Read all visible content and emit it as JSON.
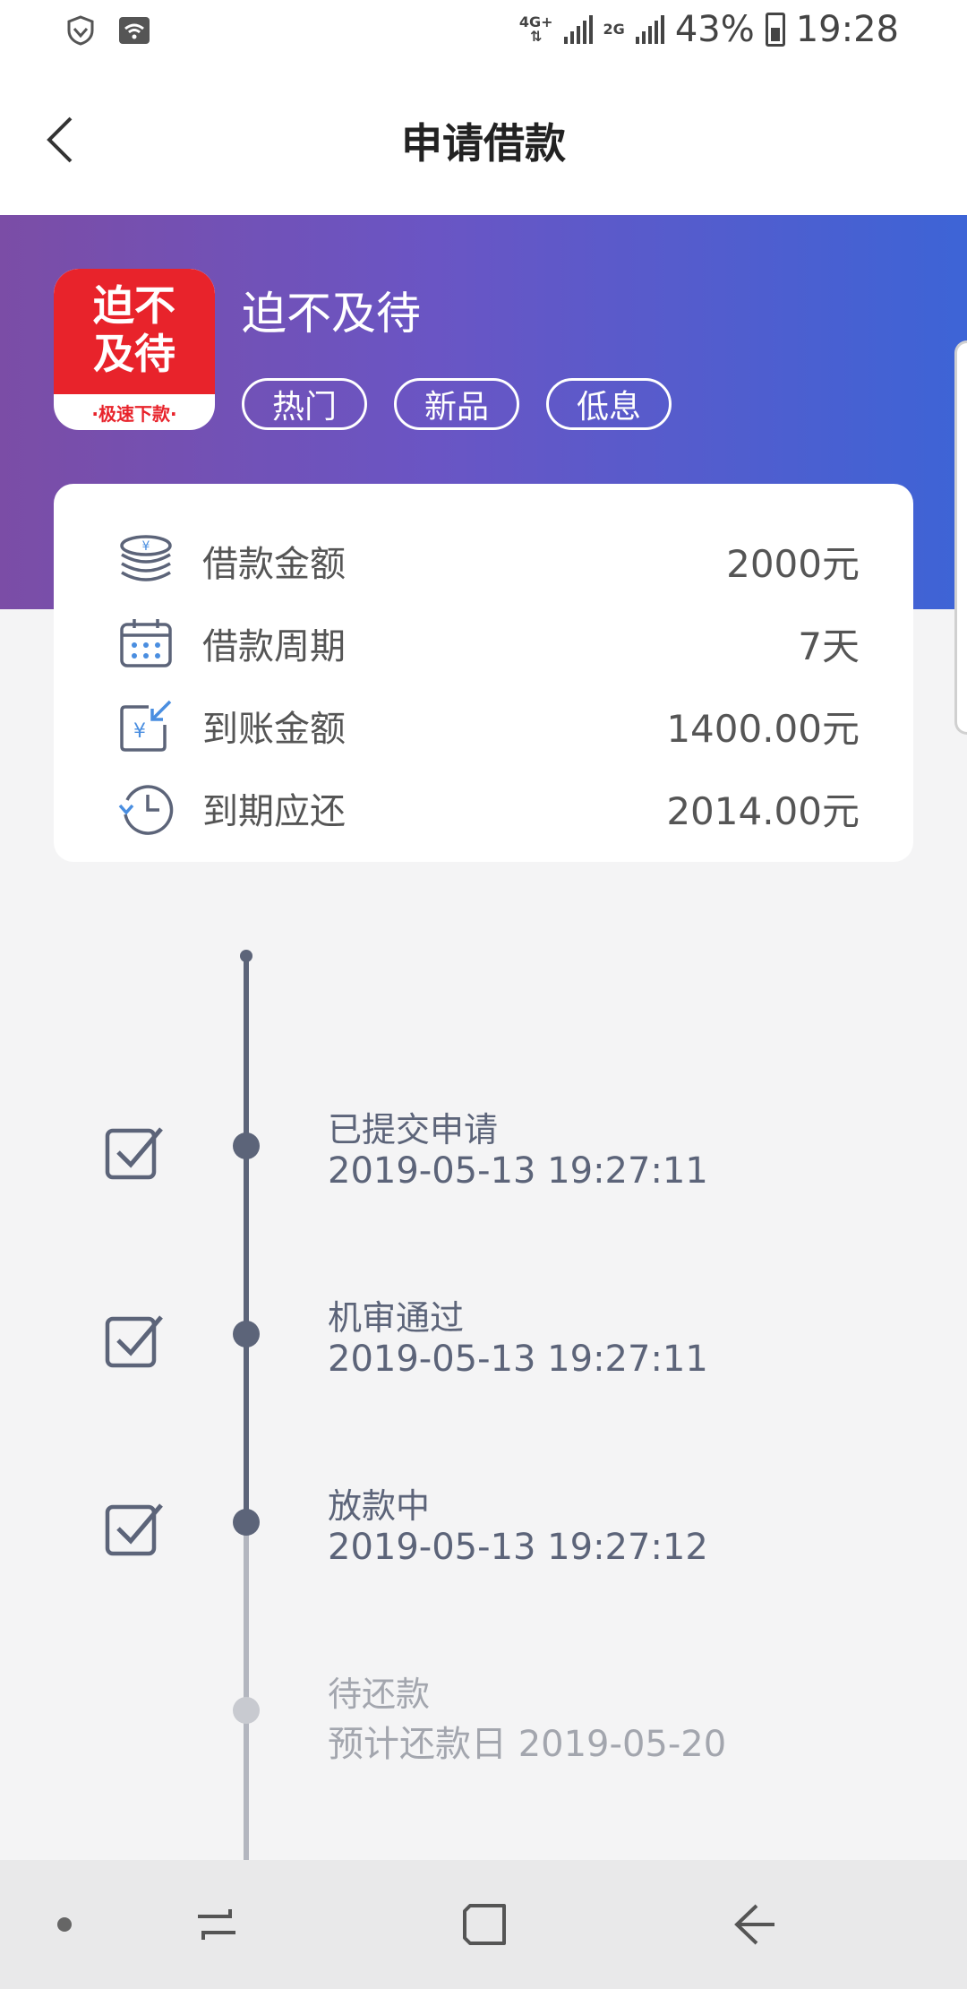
{
  "status_bar": {
    "network_top": "4G+",
    "network_second": "2G",
    "battery_percent": "43%",
    "time": "19:28"
  },
  "header": {
    "title": "申请借款"
  },
  "product": {
    "name": "迫不及待",
    "logo_line1": "迫不",
    "logo_line2": "及待",
    "logo_sub": "·极速下款·",
    "tags": [
      "热门",
      "新品",
      "低息"
    ]
  },
  "loan_info": [
    {
      "label": "借款金额",
      "value": "2000元",
      "icon": "coins-icon"
    },
    {
      "label": "借款周期",
      "value": "7天",
      "icon": "calendar-icon"
    },
    {
      "label": "到账金额",
      "value": "1400.00元",
      "icon": "yuan-arrival-icon"
    },
    {
      "label": "到期应还",
      "value": "2014.00元",
      "icon": "clock-history-icon"
    }
  ],
  "timeline": [
    {
      "title": "已提交申请",
      "time": "2019-05-13 19:27:11",
      "done": true
    },
    {
      "title": "机审通过",
      "time": "2019-05-13 19:27:11",
      "done": true
    },
    {
      "title": "放款中",
      "time": "2019-05-13 19:27:12",
      "done": true
    },
    {
      "title": "待还款",
      "time": "预计还款日 2019-05-20",
      "done": false
    }
  ],
  "colors": {
    "accent_dark": "#5c6479",
    "accent_muted": "#b3b6bf",
    "logo_red": "#e8232b",
    "banner_left": "#7b4da6",
    "banner_right": "#3d64d6"
  }
}
